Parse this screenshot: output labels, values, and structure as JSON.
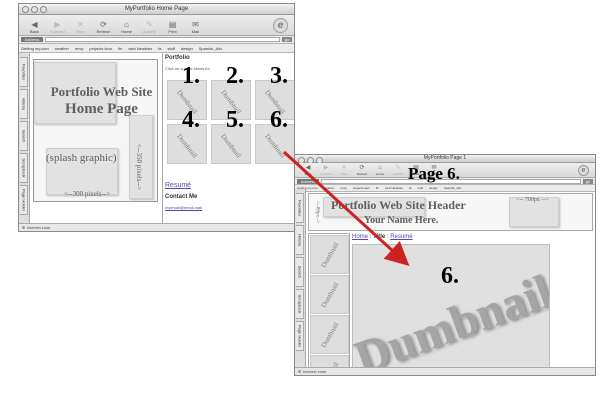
{
  "window1": {
    "title": "MyPortfolio Home Page",
    "toolbar": [
      {
        "label": "Back",
        "icon": "back-arrow-icon",
        "glyph": "◀",
        "enabled": true
      },
      {
        "label": "Forward",
        "icon": "forward-arrow-icon",
        "glyph": "▶",
        "enabled": false
      },
      {
        "label": "Stop",
        "icon": "stop-icon",
        "glyph": "✕",
        "enabled": false
      },
      {
        "label": "Refresh",
        "icon": "refresh-icon",
        "glyph": "⟳",
        "enabled": true
      },
      {
        "label": "Home",
        "icon": "home-icon",
        "glyph": "⌂",
        "enabled": true
      },
      {
        "label": "AutoFill",
        "icon": "autofill-icon",
        "glyph": "✎",
        "enabled": false
      },
      {
        "label": "Print",
        "icon": "print-icon",
        "glyph": "▤",
        "enabled": true
      },
      {
        "label": "Mail",
        "icon": "mail-icon",
        "glyph": "✉",
        "enabled": true
      }
    ],
    "address_label": "Address",
    "go_label": "go",
    "favorites": [
      "Getting my.com",
      "weather",
      "envy",
      "projects leon",
      "fin",
      "web Newbies",
      "fa",
      "stuff",
      "design",
      "Spanish_Adv"
    ],
    "side_tabs": [
      "Favorites",
      "History",
      "Search",
      "Scrapbook",
      "Page Holder"
    ],
    "splash": {
      "title_line1": "Portfolio Web Site",
      "title_line2": "Home Page",
      "graphic_label": "(splash graphic)",
      "height_label": "<--350 pixels-->",
      "width_label": "<--300 pixels-->"
    },
    "panel": {
      "heading": "Portfolio",
      "subtext": "Click on a page below for",
      "thumb_label": "Dumbnail",
      "numbers": [
        "1.",
        "2.",
        "3.",
        "4.",
        "5.",
        "6."
      ],
      "resume_link": "Resumé",
      "contact_heading": "Contact Me",
      "email": "myemail@email.mail"
    },
    "status": "Internet zone"
  },
  "window2": {
    "title": "MyPortfolio Page 1",
    "toolbar": [
      {
        "label": "Back",
        "icon": "back-arrow-icon",
        "glyph": "◀",
        "enabled": true
      },
      {
        "label": "Forward",
        "icon": "forward-arrow-icon",
        "glyph": "▶",
        "enabled": false
      },
      {
        "label": "Stop",
        "icon": "stop-icon",
        "glyph": "✕",
        "enabled": false
      },
      {
        "label": "Refresh",
        "icon": "refresh-icon",
        "glyph": "⟳",
        "enabled": true
      },
      {
        "label": "Home",
        "icon": "home-icon",
        "glyph": "⌂",
        "enabled": true
      },
      {
        "label": "AutoFill",
        "icon": "autofill-icon",
        "glyph": "✎",
        "enabled": false
      },
      {
        "label": "Print",
        "icon": "print-icon",
        "glyph": "▤",
        "enabled": true
      },
      {
        "label": "Mail",
        "icon": "mail-icon",
        "glyph": "✉",
        "enabled": true
      }
    ],
    "address_label": "Address",
    "go_label": "go",
    "favorites": [
      "Getting my.com",
      "weather",
      "envy",
      "projects leon",
      "fin",
      "web Newbies",
      "fa",
      "stuff",
      "design",
      "Spanish_Adv"
    ],
    "side_tabs": [
      "Favorites",
      "History",
      "Search",
      "Scrapbook",
      "Page Holder"
    ],
    "header": {
      "title": "Portfolio Web Site Header",
      "name": "Your Name Here.",
      "width_label": "<-- 700px -->",
      "height_label": "<--80px-->"
    },
    "thumb_label": "Dumbnail",
    "breadcrumb": {
      "home": "Home",
      "sep1": " : ",
      "title": "Title",
      "sep2": " : ",
      "resume": "Resumé"
    },
    "big_label": "Dumbnail",
    "number": "6.",
    "status": "Internet zone"
  },
  "page_label": "Page 6.",
  "colors": {
    "arrow": "#cc2222",
    "link": "#5545b3"
  }
}
